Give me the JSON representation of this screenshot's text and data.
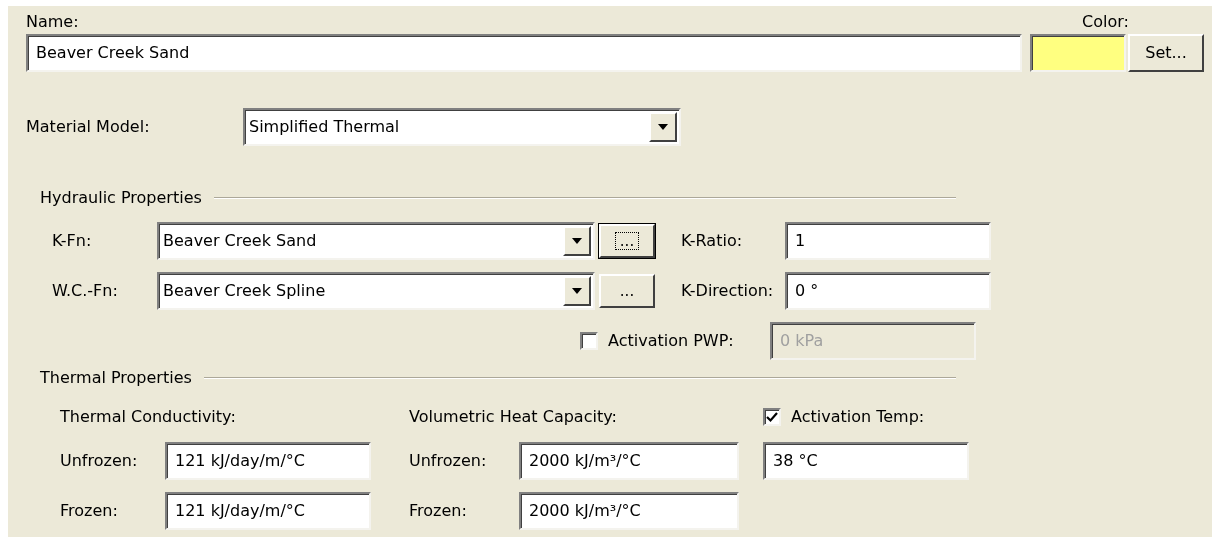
{
  "name": {
    "label": "Name:",
    "value": "Beaver Creek Sand"
  },
  "color": {
    "label": "Color:",
    "swatch": {
      "color": "#ffff80"
    },
    "button": "Set..."
  },
  "material_model": {
    "label": "Material Model:",
    "value": "Simplified Thermal"
  },
  "hydraulic": {
    "title": "Hydraulic Properties",
    "functions": [
      {
        "label": "K-Fn:",
        "value": "Beaver Creek Sand",
        "button": "...",
        "focused": true
      },
      {
        "label": "W.C.-Fn:",
        "value": "Beaver Creek Spline",
        "button": "...",
        "focused": false
      }
    ],
    "fields": [
      {
        "label": "K-Ratio:",
        "value": "1"
      },
      {
        "label": "K-Direction:",
        "value": "0 °"
      }
    ],
    "activation": {
      "label": "Activation PWP:",
      "checked": false,
      "value": "0 kPa",
      "disabled": true
    }
  },
  "thermal": {
    "title": "Thermal Properties",
    "conductivity": {
      "title": "Thermal Conductivity:",
      "rows": [
        {
          "label": "Unfrozen:",
          "value": "121 kJ/day/m/°C"
        },
        {
          "label": "Frozen:",
          "value": "121 kJ/day/m/°C"
        }
      ]
    },
    "heat_capacity": {
      "title": "Volumetric Heat Capacity:",
      "rows": [
        {
          "label": "Unfrozen:",
          "value": "2000 kJ/m³/°C"
        },
        {
          "label": "Frozen:",
          "value": "2000 kJ/m³/°C"
        }
      ]
    },
    "activation": {
      "label": "Activation Temp:",
      "checked": true,
      "value": "38 °C",
      "disabled": false
    }
  }
}
